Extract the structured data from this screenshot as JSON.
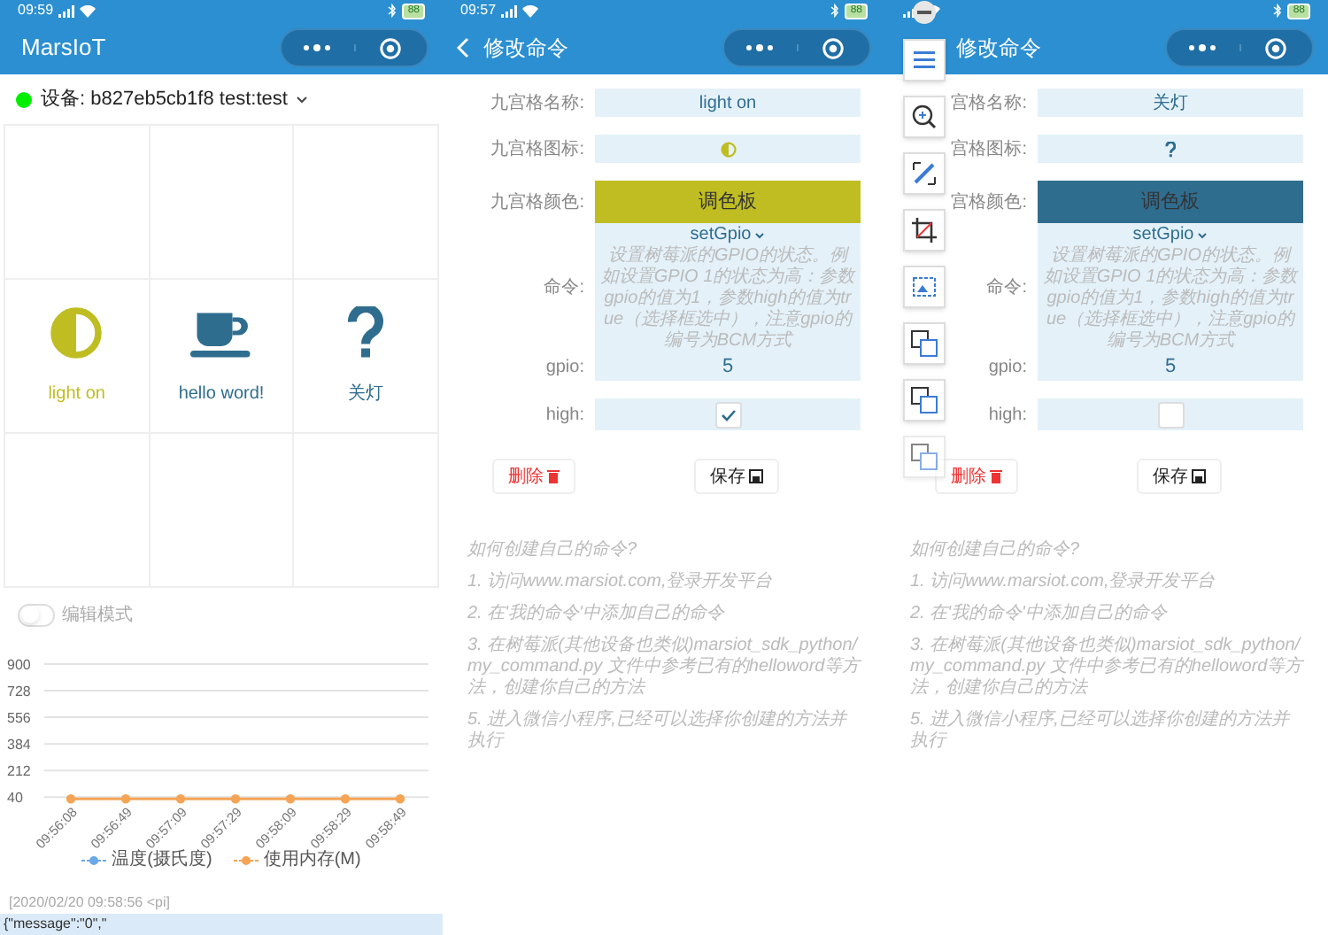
{
  "home": {
    "status_time": "09:59",
    "battery": "88",
    "title": "MarsIoT",
    "device": {
      "online": true,
      "label": "设备: b827eb5cb1f8 test:test"
    },
    "grid": [
      {
        "kind": "empty"
      },
      {
        "kind": "empty"
      },
      {
        "kind": "empty"
      },
      {
        "kind": "half-circle",
        "label": "light on",
        "color": "#bfbd22"
      },
      {
        "kind": "cup",
        "label": "hello word!",
        "color": "#2f6d8f"
      },
      {
        "kind": "question",
        "label": "关灯",
        "color": "#2f6d8f"
      },
      {
        "kind": "empty"
      },
      {
        "kind": "empty"
      },
      {
        "kind": "empty"
      }
    ],
    "edit_mode": {
      "label": "编辑模式",
      "on": false
    },
    "chart_data": {
      "type": "line",
      "categories": [
        "09:56:08",
        "09:56:49",
        "09:57:09",
        "09:57:29",
        "09:58:09",
        "09:58:29",
        "09:58:49"
      ],
      "ylim": [
        30,
        900
      ],
      "grid": true,
      "legend": true,
      "yticks": [
        40,
        212,
        384,
        556,
        728,
        900
      ],
      "series": [
        {
          "name": "温度(摄氏度)",
          "color": "#6aa8e8",
          "marker": "circle",
          "values": [
            null,
            null,
            null,
            null,
            null,
            null,
            null
          ]
        },
        {
          "name": "使用内存(M)",
          "color": "#f5a455",
          "marker": "circle",
          "values": [
            40,
            40,
            40,
            40,
            40,
            40,
            40
          ]
        }
      ]
    },
    "log": {
      "time": "[2020/02/20 09:58:56 <pi]",
      "line": "{\"message\":\"0\",\""
    }
  },
  "editors": [
    {
      "status_time": "09:57",
      "battery": "88",
      "back": true,
      "title": "修改命令",
      "name": {
        "label": "九宫格名称:",
        "value": "light on"
      },
      "icon": {
        "label": "九宫格图标:",
        "kind": "half-circle",
        "color": "#bfbd22"
      },
      "color": {
        "label": "九宫格颜色:",
        "button": "调色板",
        "color": "#bfbd22"
      },
      "command": {
        "label": "命令:",
        "value": "setGpio",
        "description": "设置树莓派的GPIO的状态。例如设置GPIO 1的状态为高：参数gpio的值为1，参数high的值为true（选择框选中），注意gpio的编号为BCM方式"
      },
      "gpio": {
        "label": "gpio:",
        "value": "5"
      },
      "high": {
        "label": "high:",
        "checked": true
      },
      "delete_button": "删除",
      "save_button": "保存",
      "help": [
        "如何创建自己的命令?",
        "1. 访问www.marsiot.com,登录开发平台",
        "2. 在'我的命令'中添加自己的命令",
        "3. 在树莓派(其他设备也类似)marsiot_sdk_python/ my_command.py 文件中参考已有的helloword等方法，创建你自己的方法",
        "5. 进入微信小程序,已经可以选择你创建的方法并执行"
      ]
    },
    {
      "battery": "88",
      "back": false,
      "title": "修改命令",
      "name": {
        "label": "宫格名称:",
        "value": "关灯"
      },
      "icon": {
        "label": "宫格图标:",
        "kind": "question",
        "color": "#2f6d8f"
      },
      "color": {
        "label": "宫格颜色:",
        "button": "调色板",
        "color": "#2f6d8f"
      },
      "command": {
        "label": "命令:",
        "value": "setGpio",
        "description": "设置树莓派的GPIO的状态。例如设置GPIO 1的状态为高：参数gpio的值为1，参数high的值为true（选择框选中），注意gpio的编号为BCM方式"
      },
      "gpio": {
        "label": "gpio:",
        "value": "5"
      },
      "high": {
        "label": "high:",
        "checked": false
      },
      "delete_button": "删除",
      "save_button": "保存",
      "help": [
        "如何创建自己的命令?",
        "1. 访问www.marsiot.com,登录开发平台",
        "2. 在'我的命令'中添加自己的命令",
        "3. 在树莓派(其他设备也类似)marsiot_sdk_python/ my_command.py 文件中参考已有的helloword等方法，创建你自己的方法",
        "5. 进入微信小程序,已经可以选择你创建的方法并执行"
      ]
    }
  ]
}
